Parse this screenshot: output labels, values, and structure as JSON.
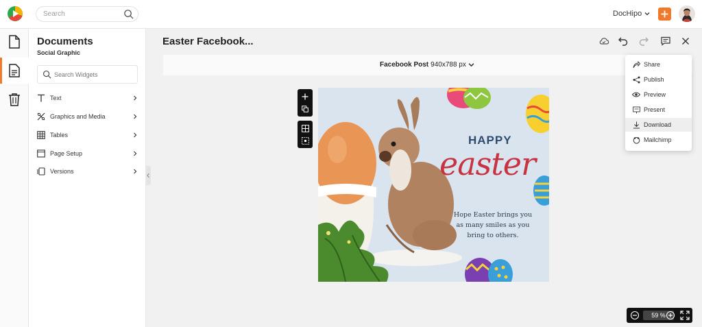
{
  "topbar": {
    "search_placeholder": "Search",
    "brand_label": "DocHipo"
  },
  "panel": {
    "title": "Documents",
    "subtitle": "Social Graphic",
    "widget_search_placeholder": "Search Widgets",
    "menu": [
      {
        "label": "Text",
        "icon": "text-icon"
      },
      {
        "label": "Graphics and Media",
        "icon": "graphics-icon"
      },
      {
        "label": "Tables",
        "icon": "table-icon"
      },
      {
        "label": "Page Setup",
        "icon": "page-setup-icon"
      },
      {
        "label": "Versions",
        "icon": "versions-icon"
      }
    ]
  },
  "document": {
    "title": "Easter Facebook...",
    "size_name": "Facebook Post",
    "size_dims": "940x788 px"
  },
  "canvas": {
    "headline_small": "HAPPY",
    "headline_large": "easter",
    "body": "Hope Easter brings you as many smiles as you bring to others."
  },
  "download_menu": {
    "items": [
      {
        "label": "Share",
        "icon": "share-icon"
      },
      {
        "label": "Publish",
        "icon": "publish-icon"
      },
      {
        "label": "Preview",
        "icon": "eye-icon"
      },
      {
        "label": "Present",
        "icon": "present-icon"
      },
      {
        "label": "Download",
        "icon": "download-icon",
        "active": true
      },
      {
        "label": "Mailchimp",
        "icon": "mailchimp-icon"
      }
    ]
  },
  "zoom": {
    "value": "59 %"
  },
  "colors": {
    "accent": "#f07a2c",
    "headline_blue": "#2f4c6e",
    "headline_red": "#c7333f"
  }
}
